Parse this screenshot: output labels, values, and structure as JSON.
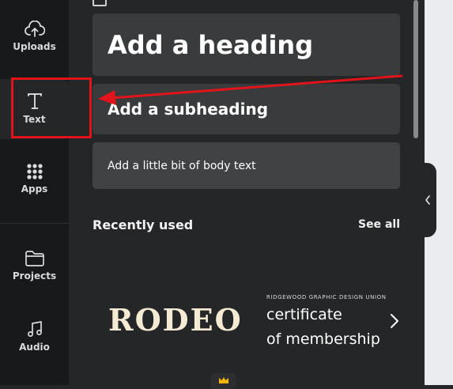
{
  "sidebar": {
    "items": [
      {
        "label": "Uploads",
        "icon": "cloud-upload-icon"
      },
      {
        "label": "Text",
        "icon": "text-icon",
        "active": true
      },
      {
        "label": "Apps",
        "icon": "apps-grid-icon"
      },
      {
        "label": "Projects",
        "icon": "folder-icon"
      },
      {
        "label": "Audio",
        "icon": "music-note-icon"
      }
    ]
  },
  "text_panel": {
    "heading_label": "Add a heading",
    "subheading_label": "Add a subheading",
    "body_label": "Add a little bit of body text"
  },
  "recently_used": {
    "title": "Recently used",
    "see_all": "See all",
    "items": [
      {
        "text": "RODEO"
      },
      {
        "small": "RIDGEWOOD GRAPHIC DESIGN UNION",
        "line1": "certificate",
        "line2": "of membership"
      }
    ]
  },
  "colors": {
    "rail_bg": "#18191b",
    "panel_bg": "#252627",
    "tile_bg": "#3a3b3d",
    "annotation_red": "#e0141a",
    "canvas_bg": "#ebecf0"
  }
}
